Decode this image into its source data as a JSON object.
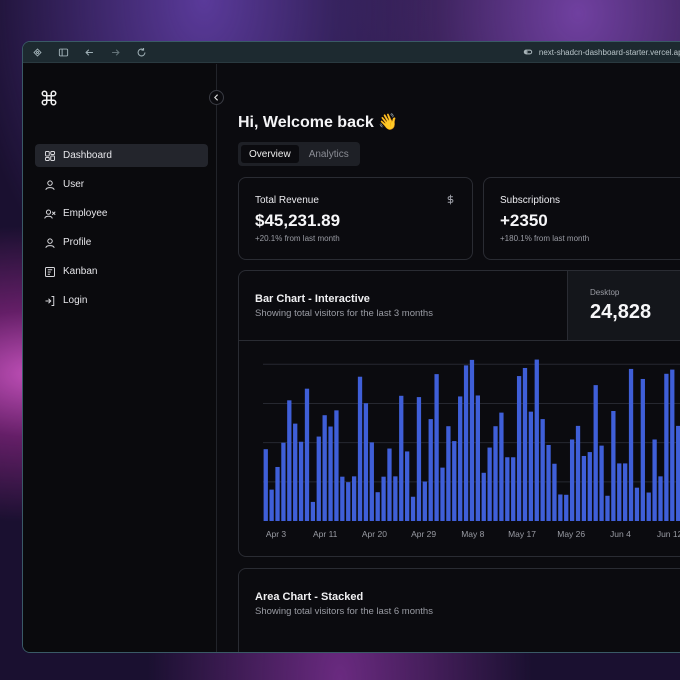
{
  "browser": {
    "url": "next-shadcn-dashboard-starter.vercel.app"
  },
  "sidebar": {
    "items": [
      {
        "label": "Dashboard",
        "icon": "dashboard-icon",
        "active": true
      },
      {
        "label": "User",
        "icon": "user-icon",
        "active": false
      },
      {
        "label": "Employee",
        "icon": "employee-icon",
        "active": false
      },
      {
        "label": "Profile",
        "icon": "profile-icon",
        "active": false
      },
      {
        "label": "Kanban",
        "icon": "kanban-icon",
        "active": false
      },
      {
        "label": "Login",
        "icon": "login-icon",
        "active": false
      }
    ]
  },
  "header": {
    "welcome": "Hi, Welcome back 👋"
  },
  "tabs": [
    {
      "label": "Overview",
      "active": true
    },
    {
      "label": "Analytics",
      "active": false
    }
  ],
  "cards": {
    "revenue": {
      "title": "Total Revenue",
      "value": "$45,231.89",
      "sub": "+20.1% from last month"
    },
    "subscriptions": {
      "title": "Subscriptions",
      "value": "+2350",
      "sub": "+180.1% from last month"
    }
  },
  "bar_chart": {
    "title": "Bar Chart - Interactive",
    "description": "Showing total visitors for the last 3 months",
    "stat_label": "Desktop",
    "stat_value": "24,828"
  },
  "area_chart": {
    "title": "Area Chart - Stacked",
    "description": "Showing total visitors for the last 6 months"
  },
  "colors": {
    "bar": "#3f5fd8",
    "grid": "#262830"
  },
  "chart_data": {
    "type": "bar",
    "x_ticks": [
      "Apr 3",
      "Apr 11",
      "Apr 20",
      "Apr 29",
      "May 8",
      "May 17",
      "May 26",
      "Jun 4",
      "Jun 12"
    ],
    "values": [
      222,
      97,
      167,
      242,
      373,
      301,
      245,
      409,
      59,
      261,
      327,
      292,
      342,
      137,
      120,
      138,
      446,
      364,
      243,
      89,
      137,
      224,
      138,
      387,
      215,
      75,
      383,
      122,
      315,
      454,
      165,
      293,
      247,
      385,
      481,
      498,
      388,
      149,
      227,
      293,
      335,
      197,
      197,
      448,
      473,
      338,
      499,
      315,
      235,
      177,
      82,
      81,
      252,
      294,
      201,
      213,
      420,
      233,
      78,
      340,
      178,
      178,
      470,
      103,
      439,
      88,
      252,
      138,
      455,
      468,
      294,
      300,
      325,
      245
    ]
  }
}
